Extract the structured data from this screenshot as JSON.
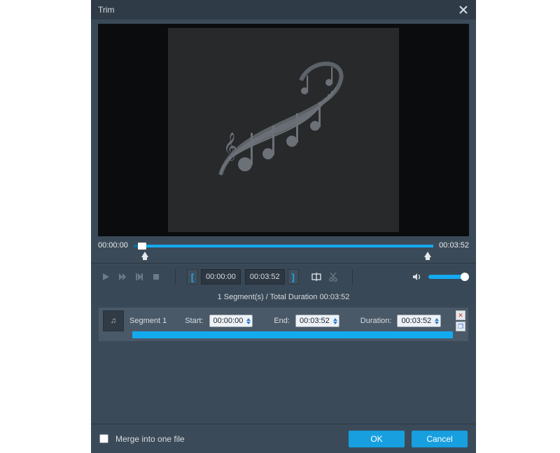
{
  "dialog": {
    "title": "Trim",
    "close_icon": "close-icon"
  },
  "timeline": {
    "current_time": "00:00:00",
    "total_time": "00:03:52"
  },
  "controls": {
    "start_tc": "00:00:00",
    "end_tc": "00:03:52"
  },
  "status": {
    "text": "1 Segment(s) / Total Duration 00:03:52"
  },
  "segment": {
    "name": "Segment 1",
    "start_label": "Start:",
    "start_value": "00:00:00",
    "end_label": "End:",
    "end_value": "00:03:52",
    "duration_label": "Duration:",
    "duration_value": "00:03:52"
  },
  "footer": {
    "merge_label": "Merge into one file",
    "ok_label": "OK",
    "cancel_label": "Cancel"
  },
  "colors": {
    "accent": "#14aaf0",
    "panel": "#3b4a58"
  }
}
